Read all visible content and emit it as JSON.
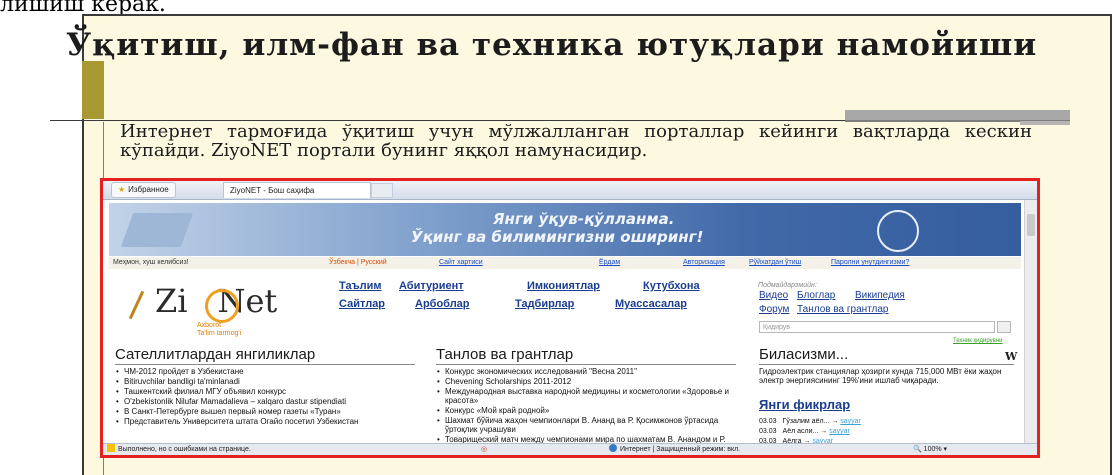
{
  "slide": {
    "top_cut_text": "лишиш керак.",
    "title": "Ўқитиш, илм-фан ва техника ютуқлари намойиши",
    "body": "Интернет тармоғида ўқитиш учун мўлжалланган порталлар кейинги вақтларда кескин кўпайди. ZiyoNET портали бунинг яққол намунасидир."
  },
  "browser": {
    "favorites_label": "Избранное",
    "tab_title": "ZiyoNET - Бош саҳифа",
    "status_left": "Выполнено, но с ошибками на странице.",
    "status_internet": "Интернет | Защищенный режим: вкл.",
    "zoom": "100%"
  },
  "site": {
    "banner_line1": "Янги ўқув-қўлланма.",
    "banner_line2": "Ўқинг ва билимингизни оширинг!",
    "greeting": "Меҳмон, хуш келибсиз!",
    "lang_links": "Ўзбекча | Русский",
    "top_links": [
      "Сайт хартиси",
      "Ёрдам",
      "Авторизация",
      "Рўйхатдан ўтиш",
      "Паролни унутдингизми?"
    ],
    "logo_left": "Zi",
    "logo_right": "Net",
    "logo_sub1": "Axborot",
    "logo_sub2": "Ta'lim tarmog'i",
    "nav_row1": [
      "Таълим",
      "Абитуриент",
      "Имкониятлар",
      "Кутубхона"
    ],
    "nav_row2": [
      "Сайтлар",
      "Арбоблар",
      "Тадбирлар",
      "Муассасалар"
    ],
    "popular_label": "Подмайдарэмийн:",
    "popular_row1": [
      "Видео",
      "Блоглар",
      "Википедия"
    ],
    "popular_row2": [
      "Форум",
      "Танлов ва грантлар"
    ],
    "search_placeholder": "Қидирув",
    "tech_search": "Техник қидирувни",
    "news_title": "Сателлитлардан янгиликлар",
    "news": [
      "ЧМ-2012 пройдет в Узбекистане",
      "Bitiruvchilar bandligi ta'minlanadi",
      "Ташкентский филиал МГУ объявил конкурс",
      "O'zbekistonlik Nilufar Mamadalieva – xalqaro dastur stipendiati",
      "В Санкт-Петербурге вышел первый номер газеты «Туран»",
      "Представитель Университета штата Огайо посетил Узбекистан"
    ],
    "grants_title": "Танлов ва грантлар",
    "grants": [
      "Конкурс экономических исследований \"Весна 2011\"",
      "Chevening Scholarships 2011-2012",
      "Международная выставка народной медицины и косметологии «Здоровье и красота»",
      "Конкурс «Мой край родной»",
      "Шахмат бўйича жаҳон чемпионлари В. Ананд ва Р. Қосимжонов ўртасида ўртоқлик учрашуви",
      "Товарищеский матч между чемпионами мира по шахматам В. Анандом и Р. Касымджановым"
    ],
    "did_you_know_title": "Биласизми...",
    "wiki_w": "W",
    "did_you_know_text": "Гидроэлектрик станциялар ҳозирги кунда 715,000 МВт ёки жаҳон электр энергиясининг 19%'ини ишлаб чиқаради.",
    "comments_title": "Янги фикрлар",
    "comments": [
      {
        "date": "03.03",
        "text": "Гўзалим аёл...",
        "author": "sayyar"
      },
      {
        "date": "03.03",
        "text": "Аёл асли...",
        "author": "sayyar"
      },
      {
        "date": "03.03",
        "text": "Аёлга",
        "author": "sayyar"
      }
    ]
  }
}
